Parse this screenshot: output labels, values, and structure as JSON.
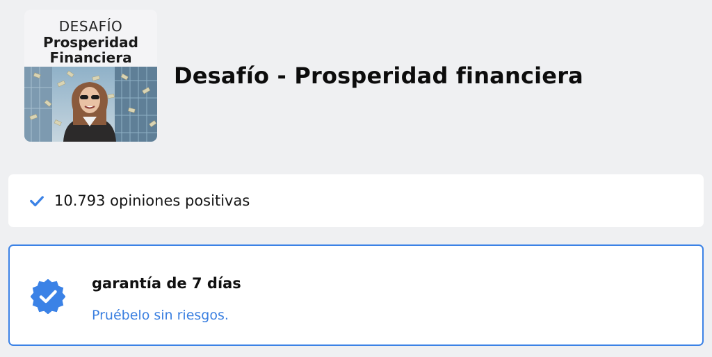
{
  "course": {
    "thumbnail": {
      "kicker": "DESAFÍO",
      "line1": "Prosperidad",
      "line2": "Financiera"
    },
    "title": "Desafío - Prosperidad financiera"
  },
  "reviews": {
    "icon": "check-icon",
    "text": "10.793 opiniones positivas"
  },
  "guarantee": {
    "icon": "verified-badge-icon",
    "title": "garantía de 7 días",
    "subtitle": "Pruébelo sin riesgos."
  },
  "colors": {
    "accent": "#3b82e6",
    "link": "#3a7fe0",
    "background": "#eff0f2"
  }
}
